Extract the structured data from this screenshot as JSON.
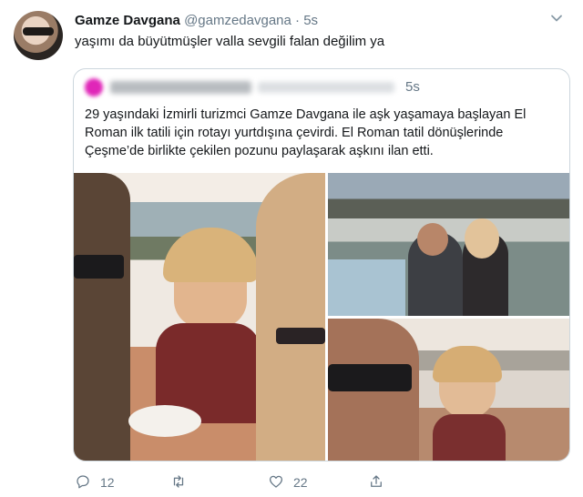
{
  "tweet": {
    "author_name": "Gamze Davgana",
    "handle": "@gamzedavgana",
    "separator": "·",
    "time": "5s",
    "text": "yaşımı da büyütmüşler valla sevgili falan değilim ya"
  },
  "quoted_tweet": {
    "time": "5s",
    "lines": [
      "29 yaşındaki İzmirli turizmci Gamze Davgana ile aşk yaşamaya başlayan El",
      "Roman ilk tatili için rotayı yurtdışına çevirdi. El Roman tatil dönüşlerinde",
      "Çeşme’de birlikte çekilen pozunu paylaşarak aşkını ilan etti."
    ]
  },
  "actions": {
    "reply_count": "12",
    "retweet_count": "",
    "like_count": "22"
  },
  "icons": {
    "more": "chevron-down-icon",
    "reply": "reply-icon",
    "retweet": "retweet-icon",
    "like": "like-icon",
    "share": "share-icon"
  },
  "colors": {
    "text_primary": "#14171a",
    "text_secondary": "#657786",
    "border": "#ccd6dd"
  }
}
